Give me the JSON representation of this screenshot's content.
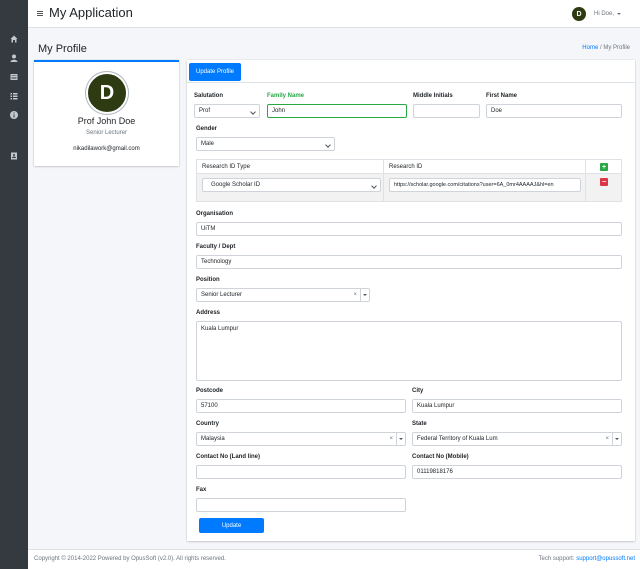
{
  "app": {
    "title": "My Application",
    "user_greeting": "Hi Doe,",
    "user_initial": "D"
  },
  "sidebar": {
    "items": [
      {
        "icon": "home-icon"
      },
      {
        "icon": "user-icon"
      },
      {
        "icon": "list-alt-icon"
      },
      {
        "icon": "list-icon"
      },
      {
        "icon": "info-icon"
      },
      {
        "icon": "id-card-icon"
      }
    ]
  },
  "page": {
    "heading": "My Profile",
    "breadcrumb_home": "Home",
    "breadcrumb_sep": "/",
    "breadcrumb_current": "My Profile"
  },
  "profile_card": {
    "initial": "D",
    "name": "Prof John Doe",
    "role": "Senior Lecturer",
    "email": "nikadilawork@gmail.com"
  },
  "form": {
    "tab_label": "Update Profile",
    "salutation": {
      "label": "Salutation",
      "value": "Prof"
    },
    "family_name": {
      "label": "Family Name",
      "value": "John"
    },
    "middle_initials": {
      "label": "Middle Initials",
      "value": ""
    },
    "first_name": {
      "label": "First Name",
      "value": "Doe"
    },
    "gender": {
      "label": "Gender",
      "value": "Male"
    },
    "research": {
      "col_type": "Research ID Type",
      "col_id": "Research ID",
      "rows": [
        {
          "type": "Google Scholar ID",
          "id": "https://scholar.google.com/citations?user=6A_0mr4AAAAJ&hl=en"
        }
      ],
      "add_symbol": "+",
      "remove_symbol": "−"
    },
    "organisation": {
      "label": "Organisation",
      "value": "UiTM"
    },
    "faculty": {
      "label": "Faculty / Dept",
      "value": "Technology"
    },
    "position": {
      "label": "Position",
      "value": "Senior Lecturer"
    },
    "address": {
      "label": "Address",
      "value": "Kuala Lumpur"
    },
    "postcode": {
      "label": "Postcode",
      "value": "57100"
    },
    "city": {
      "label": "City",
      "value": "Kuala Lumpur"
    },
    "country": {
      "label": "Country",
      "value": "Malaysia"
    },
    "state": {
      "label": "State",
      "value": "Federal Territory of Kuala Lum"
    },
    "contact_land": {
      "label": "Contact No (Land line)",
      "value": ""
    },
    "contact_mobile": {
      "label": "Contact No (Mobile)",
      "value": "01119818176"
    },
    "fax": {
      "label": "Fax",
      "value": ""
    },
    "clear_symbol": "×",
    "submit_label": "Update"
  },
  "footer": {
    "copyright": "Copyright © 2014-2022 Powered by OpusSoft (v2.0). All rights reserved.",
    "support_label": "Tech support:",
    "support_email": "support@opussoft.net"
  },
  "colors": {
    "primary": "#007bff",
    "sidebar": "#343a40",
    "avatar": "#2d3a12",
    "success": "#28a745",
    "danger": "#dc3545"
  }
}
